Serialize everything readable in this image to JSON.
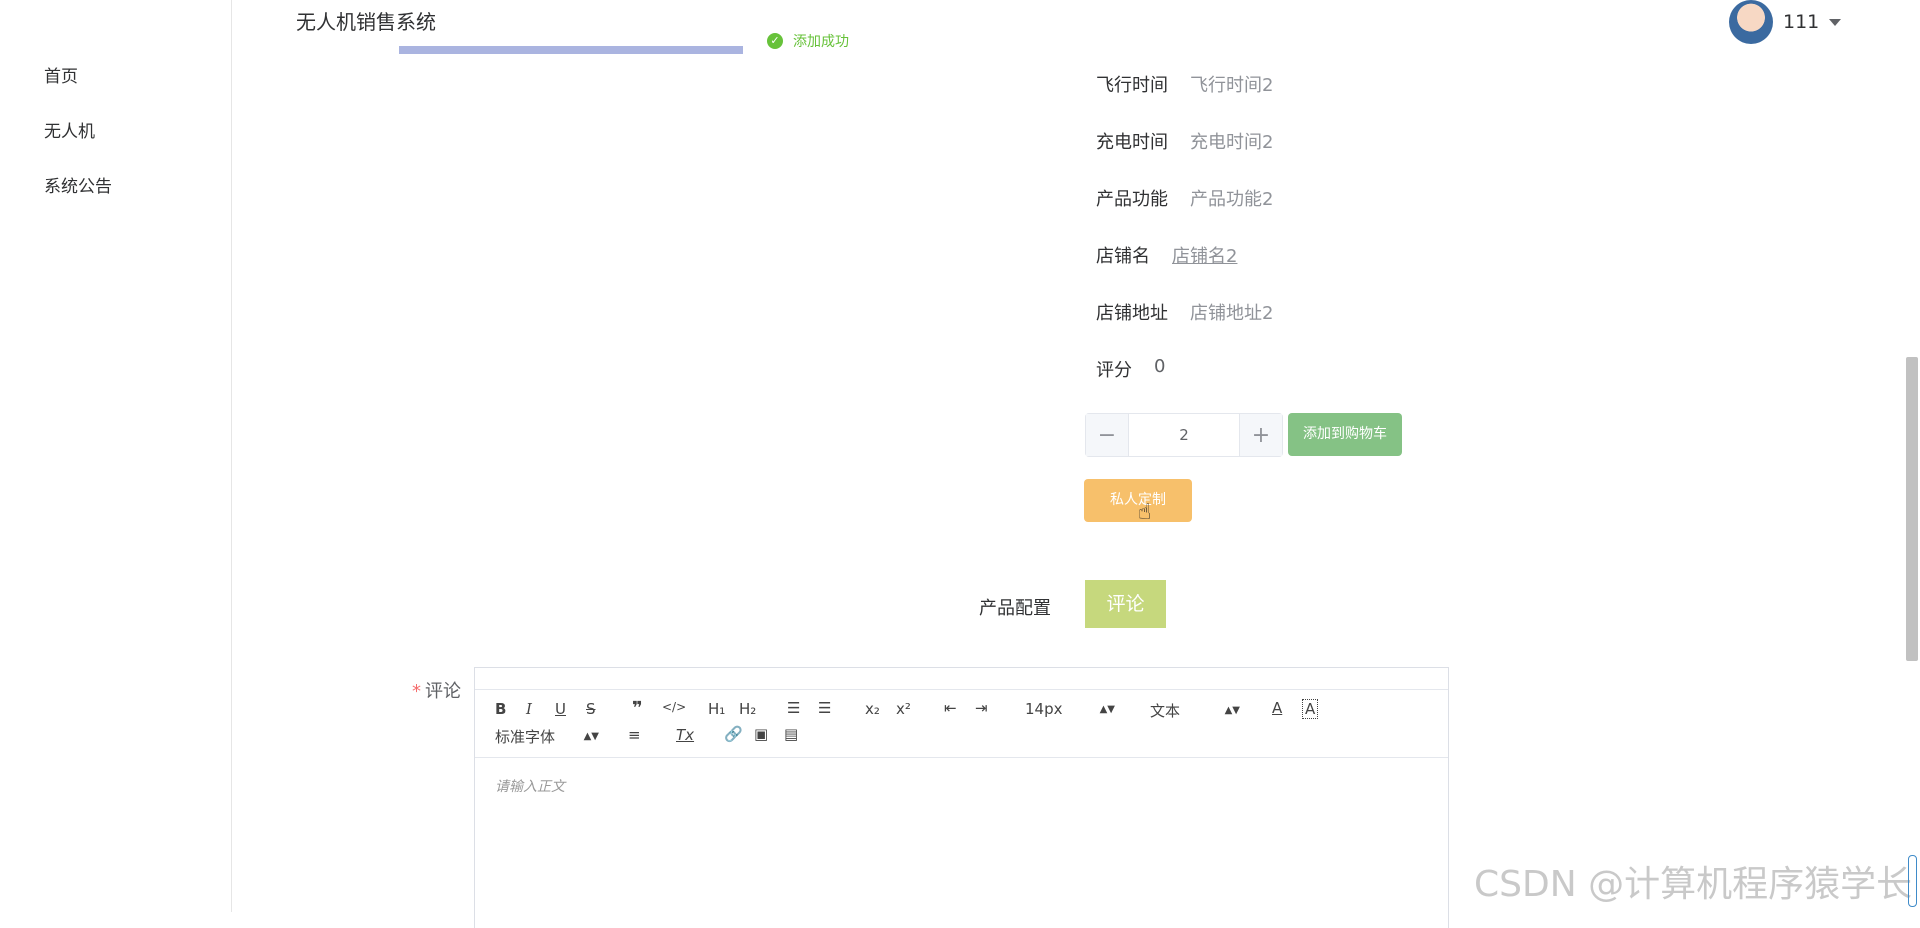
{
  "app": {
    "title": "无人机销售系统"
  },
  "sidebar": {
    "items": [
      {
        "label": "首页"
      },
      {
        "label": "无人机"
      },
      {
        "label": "系统公告"
      }
    ]
  },
  "toast": {
    "message": "添加成功",
    "color": "#67c23a"
  },
  "user": {
    "name": "111"
  },
  "details": [
    {
      "label": "飞行时间",
      "value": "飞行时间2"
    },
    {
      "label": "充电时间",
      "value": "充电时间2"
    },
    {
      "label": "产品功能",
      "value": "产品功能2"
    },
    {
      "label": "店铺名",
      "value": "店铺名2"
    },
    {
      "label": "店铺地址",
      "value": "店铺地址2"
    },
    {
      "label": "评分",
      "value": "0"
    }
  ],
  "quantity": {
    "value": "2",
    "minus": "−",
    "plus": "+"
  },
  "buttons": {
    "add_to_cart": "添加到购物车",
    "custom": "私人定制"
  },
  "tabs": {
    "config": "产品配置",
    "comment": "评论"
  },
  "comment_form": {
    "label": "评论",
    "required": "*",
    "placeholder": "请输入正文",
    "font_size": "14px",
    "text_style": "文本",
    "font_family": "标准字体"
  },
  "watermark": "CSDN @计算机程序猿学长"
}
